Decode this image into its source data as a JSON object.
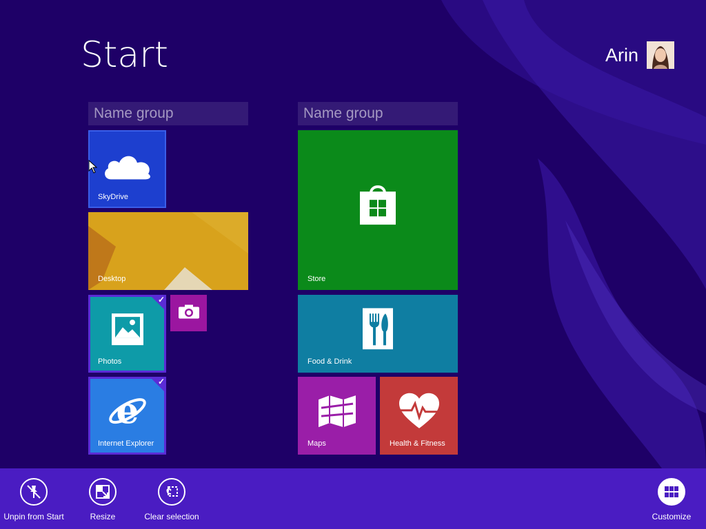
{
  "header": {
    "title": "Start",
    "user_name": "Arin"
  },
  "groups": [
    {
      "name": "Name group"
    },
    {
      "name": "Name group"
    }
  ],
  "tiles": {
    "skydrive": {
      "label": "SkyDrive",
      "color": "#1d3fcf",
      "icon": "cloud-icon",
      "selected": false
    },
    "desktop": {
      "label": "Desktop",
      "color": "#d49a14",
      "icon": "",
      "selected": false
    },
    "photos": {
      "label": "Photos",
      "color": "#0e9ba8",
      "icon": "photo-icon",
      "selected": true
    },
    "camera": {
      "label": "",
      "color": "#9b16a0",
      "icon": "camera-icon",
      "selected": false
    },
    "ie": {
      "label": "Internet Explorer",
      "color": "#2a7de3",
      "icon": "ie-icon",
      "selected": true
    },
    "store": {
      "label": "Store",
      "color": "#0b8a1a",
      "icon": "store-bag-icon",
      "selected": false
    },
    "food": {
      "label": "Food & Drink",
      "color": "#0f7ea2",
      "icon": "fork-knife-icon",
      "selected": false
    },
    "maps": {
      "label": "Maps",
      "color": "#9a1ea8",
      "icon": "map-icon",
      "selected": false
    },
    "health": {
      "label": "Health & Fitness",
      "color": "#c33a3a",
      "icon": "heart-pulse-icon",
      "selected": false
    }
  },
  "appbar": {
    "unpin_label": "Unpin from Start",
    "resize_label": "Resize",
    "clear_label": "Clear selection",
    "customize_label": "Customize",
    "color": "#4a1cc2"
  },
  "colors": {
    "background": "#1e0067",
    "accent": "#5b2cd6"
  }
}
